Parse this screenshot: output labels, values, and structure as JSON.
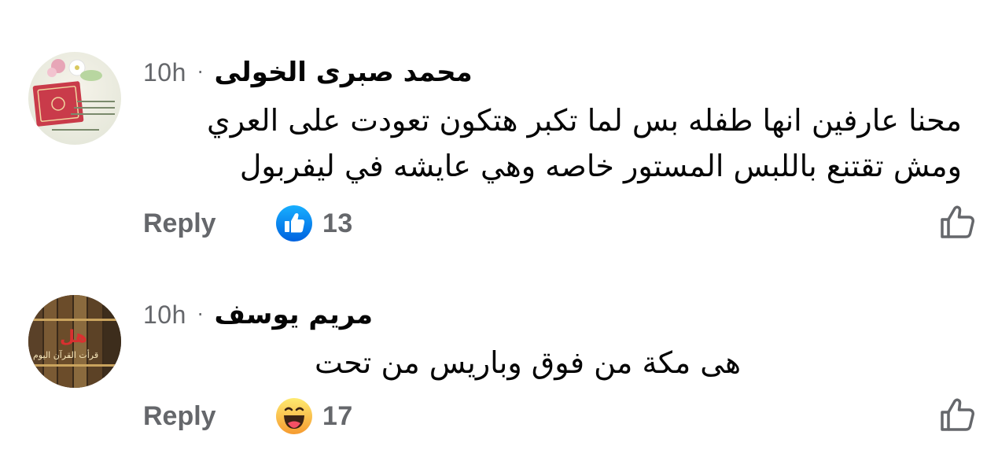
{
  "comments": [
    {
      "author": "محمد صبرى  الخولى",
      "timestamp": "10h",
      "separator": "·",
      "text": "محنا عارفين انها طفله بس لما تكبر هتكون تعودت على العري\nومش تقتنع باللبس المستور خاصه وهي عايشه في ليفربول",
      "reply_label": "Reply",
      "reaction": {
        "icon": "like-reaction-icon",
        "count": "13",
        "color": "#1877f2"
      },
      "avatar_caption": "",
      "like_button_icon": "thumbs-up-outline-icon"
    },
    {
      "author": "مريم  يوسف",
      "timestamp": "10h",
      "separator": "·",
      "text": "هى مكة من فوق وباريس من تحت",
      "reply_label": "Reply",
      "reaction": {
        "icon": "haha-reaction-icon",
        "count": "17",
        "color": "#f7b928"
      },
      "avatar_caption_top": "هل",
      "avatar_caption_bottom": "قرأت القرآن اليوم",
      "like_button_icon": "thumbs-up-outline-icon"
    }
  ]
}
